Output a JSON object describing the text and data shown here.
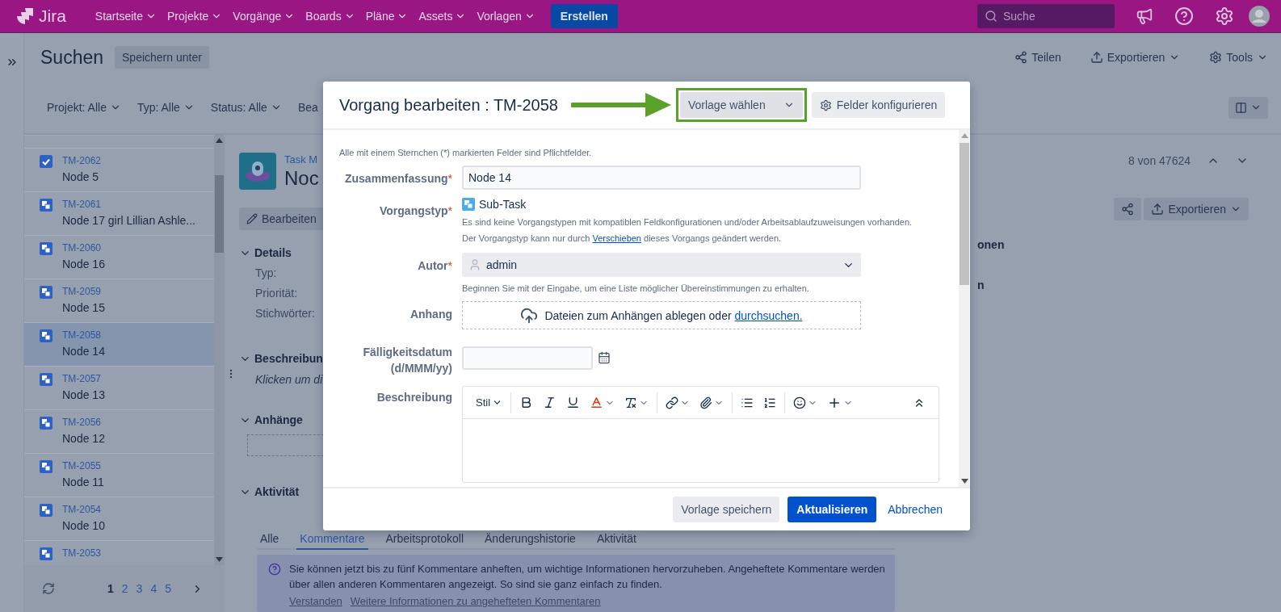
{
  "nav": {
    "logo": "Jira",
    "menus": [
      "Startseite",
      "Projekte",
      "Vorgänge",
      "Boards",
      "Pläne",
      "Assets",
      "Vorlagen"
    ],
    "create": "Erstellen",
    "search": {
      "placeholder": "Suche"
    }
  },
  "header": {
    "title": "Suchen",
    "save_as": "Speichern unter",
    "actions": [
      {
        "kind": "share",
        "label": "Teilen",
        "dropdown": false
      },
      {
        "kind": "export",
        "label": "Exportieren",
        "dropdown": true
      },
      {
        "kind": "tools",
        "label": "Tools",
        "dropdown": true
      }
    ]
  },
  "filters": [
    "Projekt: Alle",
    "Typ: Alle",
    "Status: Alle",
    "Bea"
  ],
  "issue_list": {
    "items": [
      {
        "key": "TM-2062",
        "summary": "Node 5",
        "kind": "task",
        "selected": false
      },
      {
        "key": "TM-2061",
        "summary": "Node 17 girl Lillian Ashle...",
        "kind": "subtask",
        "selected": false
      },
      {
        "key": "TM-2060",
        "summary": "Node 16",
        "kind": "subtask",
        "selected": false
      },
      {
        "key": "TM-2059",
        "summary": "Node 15",
        "kind": "subtask",
        "selected": false
      },
      {
        "key": "TM-2058",
        "summary": "Node 14",
        "kind": "subtask",
        "selected": true
      },
      {
        "key": "TM-2057",
        "summary": "Node 13",
        "kind": "subtask",
        "selected": false
      },
      {
        "key": "TM-2056",
        "summary": "Node 12",
        "kind": "subtask",
        "selected": false
      },
      {
        "key": "TM-2055",
        "summary": "Node 11",
        "kind": "subtask",
        "selected": false
      },
      {
        "key": "TM-2054",
        "summary": "Node 10",
        "kind": "subtask",
        "selected": false
      },
      {
        "key": "TM-2053",
        "kind": "subtask",
        "selected": false
      }
    ],
    "pages": [
      {
        "label": "1",
        "selected": true
      },
      {
        "label": "2",
        "selected": false
      },
      {
        "label": "3",
        "selected": false
      },
      {
        "label": "4",
        "selected": false
      },
      {
        "label": "5",
        "selected": false
      }
    ]
  },
  "issue": {
    "project": "Task M",
    "title": "Noc",
    "edit": "Bearbeiten",
    "position": "8 von 47624",
    "export": "Exportieren",
    "details": {
      "heading": "Details",
      "fields": [
        "Typ:",
        "Priorität:",
        "Stichwörter:"
      ]
    },
    "description": {
      "heading": "Beschreibun",
      "text": "Klicken um di"
    },
    "attachments": {
      "heading": "Anhänge"
    },
    "activity": {
      "heading": "Aktivität",
      "tabs": [
        {
          "label": "Alle",
          "selected": false
        },
        {
          "label": "Kommentare",
          "selected": true
        },
        {
          "label": "Arbeitsprotokoll",
          "selected": false
        },
        {
          "label": "Änderungshistorie",
          "selected": false
        },
        {
          "label": "Aktivität",
          "selected": false
        }
      ]
    },
    "notice": {
      "text": "Sie können jetzt bis zu fünf Kommentare anheften, um wichtige Informationen hervorzuheben. Angeheftete Kommentare werden über allen anderen Kommentaren angezeigt. So sind sie ganz einfach zu finden.",
      "links": [
        "Verstanden",
        "Weitere Informationen zu angehefteten Kommentaren"
      ]
    },
    "side_headings": [
      "onen",
      "n"
    ]
  },
  "dialog": {
    "title": "Vorgang bearbeiten : TM-2058",
    "template_select": "Vorlage wählen",
    "configure": "Felder konfigurieren",
    "required_note": "Alle mit einem Sternchen (*) markierten Felder sind Pflichtfelder.",
    "required_mark": "*",
    "fields": [
      {
        "kind": "text",
        "label": "Zusammenfassung",
        "required": true,
        "value": "Node 14"
      },
      {
        "kind": "issuetype",
        "label": "Vorgangstyp",
        "required": true,
        "value": "Sub-Task",
        "note": "Es sind keine Vorgangstypen mit kompatiblen Feldkonfigurationen und/oder Arbeitsablaufzuweisungen vorhanden.",
        "move_note": {
          "before": "Der Vorgangstyp kann nur durch",
          "link": "Verschieben",
          "after": "dieses Vorgangs geändert werden."
        }
      },
      {
        "kind": "user",
        "label": "Autor",
        "required": true,
        "value": "admin",
        "hint": "Beginnen Sie mit der Eingabe, um eine Liste möglicher Übereinstimmungen zu erhalten."
      },
      {
        "kind": "dropzone",
        "label": "Anhang",
        "required": false,
        "text": "Dateien zum Anhängen ablegen oder",
        "link": "durchsuchen."
      },
      {
        "kind": "date",
        "label": "Fälligkeitsdatum (d/MMM/yy)",
        "required": false
      },
      {
        "kind": "editor",
        "label": "Beschreibung",
        "required": false,
        "style_menu": "Stil"
      }
    ],
    "footer": {
      "save_template": "Vorlage speichern",
      "submit": "Aktualisieren",
      "cancel": "Abbrechen"
    }
  }
}
